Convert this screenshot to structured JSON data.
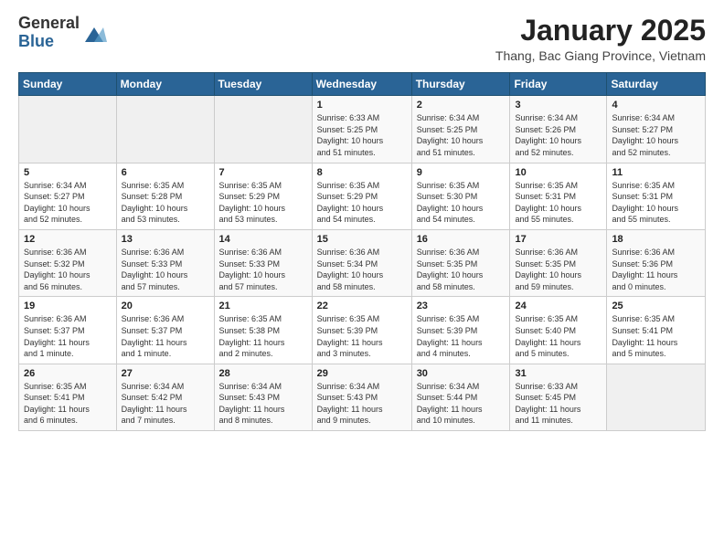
{
  "header": {
    "logo_general": "General",
    "logo_blue": "Blue",
    "month_year": "January 2025",
    "location": "Thang, Bac Giang Province, Vietnam"
  },
  "days_of_week": [
    "Sunday",
    "Monday",
    "Tuesday",
    "Wednesday",
    "Thursday",
    "Friday",
    "Saturday"
  ],
  "weeks": [
    [
      {
        "day": "",
        "info": ""
      },
      {
        "day": "",
        "info": ""
      },
      {
        "day": "",
        "info": ""
      },
      {
        "day": "1",
        "info": "Sunrise: 6:33 AM\nSunset: 5:25 PM\nDaylight: 10 hours\nand 51 minutes."
      },
      {
        "day": "2",
        "info": "Sunrise: 6:34 AM\nSunset: 5:25 PM\nDaylight: 10 hours\nand 51 minutes."
      },
      {
        "day": "3",
        "info": "Sunrise: 6:34 AM\nSunset: 5:26 PM\nDaylight: 10 hours\nand 52 minutes."
      },
      {
        "day": "4",
        "info": "Sunrise: 6:34 AM\nSunset: 5:27 PM\nDaylight: 10 hours\nand 52 minutes."
      }
    ],
    [
      {
        "day": "5",
        "info": "Sunrise: 6:34 AM\nSunset: 5:27 PM\nDaylight: 10 hours\nand 52 minutes."
      },
      {
        "day": "6",
        "info": "Sunrise: 6:35 AM\nSunset: 5:28 PM\nDaylight: 10 hours\nand 53 minutes."
      },
      {
        "day": "7",
        "info": "Sunrise: 6:35 AM\nSunset: 5:29 PM\nDaylight: 10 hours\nand 53 minutes."
      },
      {
        "day": "8",
        "info": "Sunrise: 6:35 AM\nSunset: 5:29 PM\nDaylight: 10 hours\nand 54 minutes."
      },
      {
        "day": "9",
        "info": "Sunrise: 6:35 AM\nSunset: 5:30 PM\nDaylight: 10 hours\nand 54 minutes."
      },
      {
        "day": "10",
        "info": "Sunrise: 6:35 AM\nSunset: 5:31 PM\nDaylight: 10 hours\nand 55 minutes."
      },
      {
        "day": "11",
        "info": "Sunrise: 6:35 AM\nSunset: 5:31 PM\nDaylight: 10 hours\nand 55 minutes."
      }
    ],
    [
      {
        "day": "12",
        "info": "Sunrise: 6:36 AM\nSunset: 5:32 PM\nDaylight: 10 hours\nand 56 minutes."
      },
      {
        "day": "13",
        "info": "Sunrise: 6:36 AM\nSunset: 5:33 PM\nDaylight: 10 hours\nand 57 minutes."
      },
      {
        "day": "14",
        "info": "Sunrise: 6:36 AM\nSunset: 5:33 PM\nDaylight: 10 hours\nand 57 minutes."
      },
      {
        "day": "15",
        "info": "Sunrise: 6:36 AM\nSunset: 5:34 PM\nDaylight: 10 hours\nand 58 minutes."
      },
      {
        "day": "16",
        "info": "Sunrise: 6:36 AM\nSunset: 5:35 PM\nDaylight: 10 hours\nand 58 minutes."
      },
      {
        "day": "17",
        "info": "Sunrise: 6:36 AM\nSunset: 5:35 PM\nDaylight: 10 hours\nand 59 minutes."
      },
      {
        "day": "18",
        "info": "Sunrise: 6:36 AM\nSunset: 5:36 PM\nDaylight: 11 hours\nand 0 minutes."
      }
    ],
    [
      {
        "day": "19",
        "info": "Sunrise: 6:36 AM\nSunset: 5:37 PM\nDaylight: 11 hours\nand 1 minute."
      },
      {
        "day": "20",
        "info": "Sunrise: 6:36 AM\nSunset: 5:37 PM\nDaylight: 11 hours\nand 1 minute."
      },
      {
        "day": "21",
        "info": "Sunrise: 6:35 AM\nSunset: 5:38 PM\nDaylight: 11 hours\nand 2 minutes."
      },
      {
        "day": "22",
        "info": "Sunrise: 6:35 AM\nSunset: 5:39 PM\nDaylight: 11 hours\nand 3 minutes."
      },
      {
        "day": "23",
        "info": "Sunrise: 6:35 AM\nSunset: 5:39 PM\nDaylight: 11 hours\nand 4 minutes."
      },
      {
        "day": "24",
        "info": "Sunrise: 6:35 AM\nSunset: 5:40 PM\nDaylight: 11 hours\nand 5 minutes."
      },
      {
        "day": "25",
        "info": "Sunrise: 6:35 AM\nSunset: 5:41 PM\nDaylight: 11 hours\nand 5 minutes."
      }
    ],
    [
      {
        "day": "26",
        "info": "Sunrise: 6:35 AM\nSunset: 5:41 PM\nDaylight: 11 hours\nand 6 minutes."
      },
      {
        "day": "27",
        "info": "Sunrise: 6:34 AM\nSunset: 5:42 PM\nDaylight: 11 hours\nand 7 minutes."
      },
      {
        "day": "28",
        "info": "Sunrise: 6:34 AM\nSunset: 5:43 PM\nDaylight: 11 hours\nand 8 minutes."
      },
      {
        "day": "29",
        "info": "Sunrise: 6:34 AM\nSunset: 5:43 PM\nDaylight: 11 hours\nand 9 minutes."
      },
      {
        "day": "30",
        "info": "Sunrise: 6:34 AM\nSunset: 5:44 PM\nDaylight: 11 hours\nand 10 minutes."
      },
      {
        "day": "31",
        "info": "Sunrise: 6:33 AM\nSunset: 5:45 PM\nDaylight: 11 hours\nand 11 minutes."
      },
      {
        "day": "",
        "info": ""
      }
    ]
  ]
}
